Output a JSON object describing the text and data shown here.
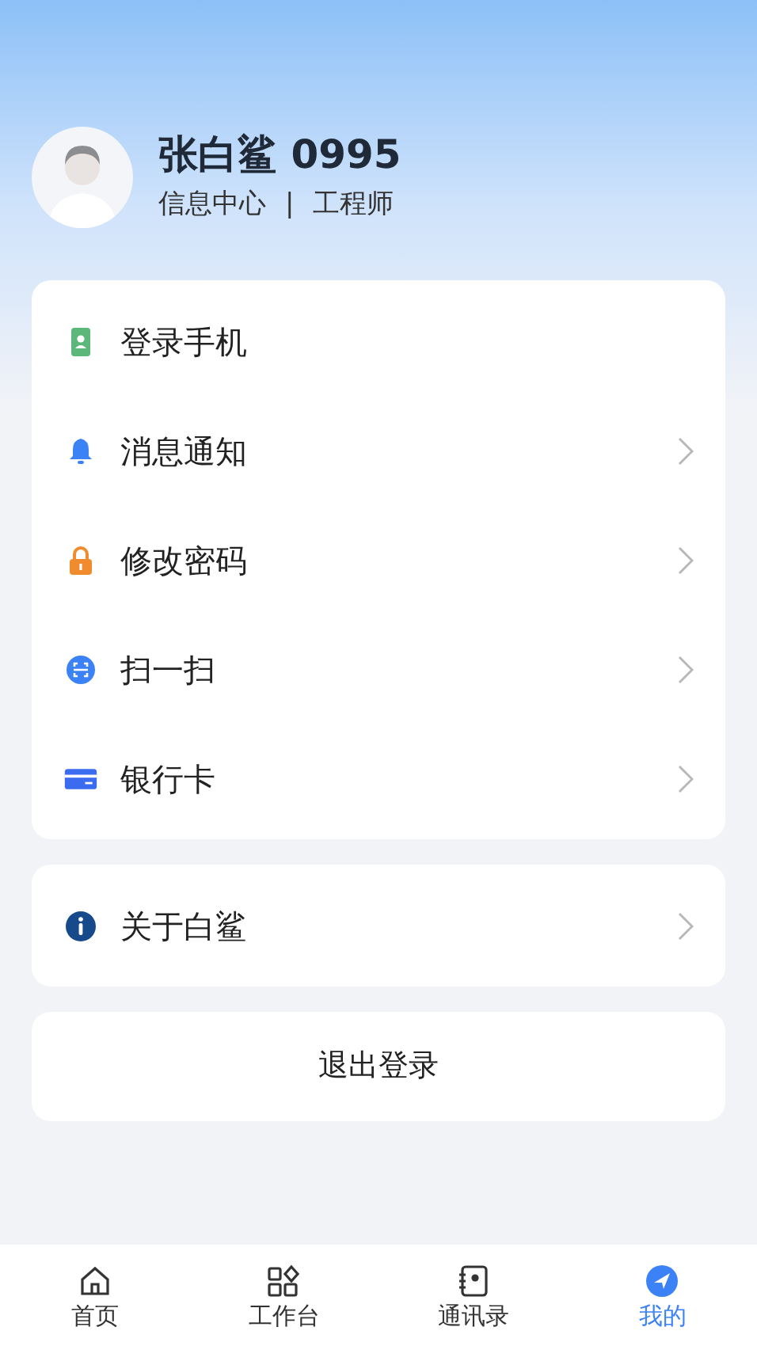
{
  "profile": {
    "name": "张白鲨 0995",
    "department": "信息中心",
    "separator": "|",
    "role": "工程师"
  },
  "menu_groups": [
    {
      "items": [
        {
          "kind": "phone",
          "label": "登录手机",
          "chevron": false
        },
        {
          "kind": "bell",
          "label": "消息通知",
          "chevron": true
        },
        {
          "kind": "lock",
          "label": "修改密码",
          "chevron": true
        },
        {
          "kind": "scan",
          "label": "扫一扫",
          "chevron": true
        },
        {
          "kind": "card",
          "label": "银行卡",
          "chevron": true
        }
      ]
    },
    {
      "items": [
        {
          "kind": "info",
          "label": "关于白鲨",
          "chevron": true
        }
      ]
    }
  ],
  "logout_button": "退出登录",
  "tab_bar": [
    {
      "kind": "home",
      "label": "首页",
      "selected": false
    },
    {
      "kind": "apps",
      "label": "工作台",
      "selected": false
    },
    {
      "kind": "contacts",
      "label": "通讯录",
      "selected": false
    },
    {
      "kind": "me",
      "label": "我的",
      "selected": true
    }
  ]
}
